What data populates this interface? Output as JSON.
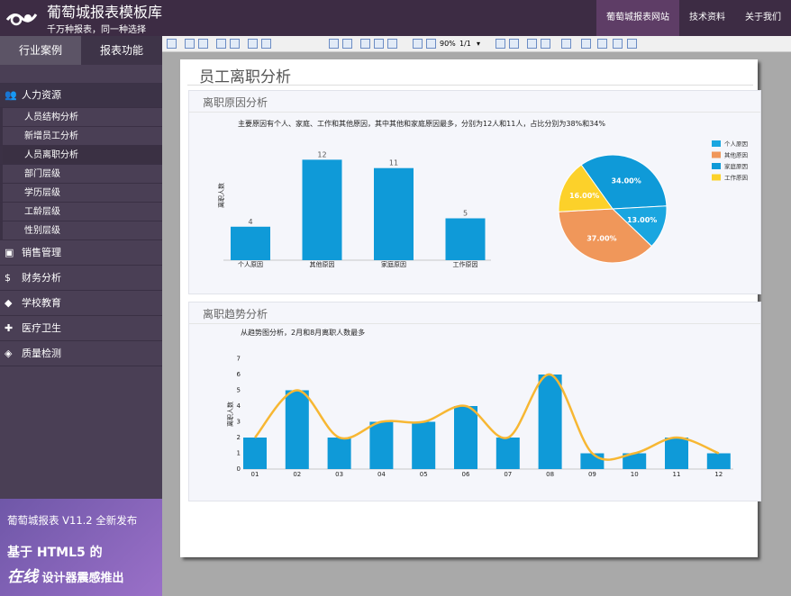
{
  "header": {
    "brand": "葡萄城报表模板库",
    "slogan": "千万种报表，同一种选择",
    "nav": [
      "葡萄城报表网站",
      "技术资料",
      "关于我们"
    ]
  },
  "sidebar": {
    "tabs": [
      "行业案例",
      "报表功能"
    ],
    "groups": [
      {
        "label": "人力资源",
        "icon": "people-icon",
        "items": [
          "人员结构分析",
          "新增员工分析",
          "人员离职分析",
          "部门层级",
          "学历层级",
          "工龄层级",
          "性别层级"
        ]
      },
      {
        "label": "销售管理",
        "icon": "chart-icon"
      },
      {
        "label": "财务分析",
        "icon": "money-bag-icon"
      },
      {
        "label": "学校教育",
        "icon": "graduation-cap-icon"
      },
      {
        "label": "医疗卫生",
        "icon": "medical-kit-icon"
      },
      {
        "label": "质量检测",
        "icon": "quality-badge-icon"
      }
    ],
    "promo": {
      "line1": "葡萄城报表 V11.2 全新发布",
      "line2": "基于 HTML5 的",
      "line3a": "在线",
      "line3b": " 设计器震感推出"
    }
  },
  "toolbar": {
    "zoom": "90%",
    "page": "1/1"
  },
  "report": {
    "title": "员工离职分析",
    "panel1": {
      "title": "离职原因分析",
      "desc": "主要原因有个人、家庭、工作和其他原因，其中其他和家庭原因最多，分别为12人和11人，占比分别为38%和34%"
    },
    "panel2": {
      "title": "离职趋势分析",
      "desc": "从趋势图分析，2月和8月离职人数最多"
    }
  },
  "chart_data": [
    {
      "type": "bar",
      "categories": [
        "个人原因",
        "其他原因",
        "家庭原因",
        "工作原因"
      ],
      "values": [
        4,
        12,
        11,
        5
      ],
      "ylabel": "离职人数",
      "color": "#0f9ad8"
    },
    {
      "type": "pie",
      "labels": [
        "个人原因",
        "其他原因",
        "家庭原因",
        "工作原因"
      ],
      "values": [
        13.0,
        37.0,
        34.0,
        16.0
      ],
      "colors": [
        "#1aa6e0",
        "#f0975a",
        "#0f9ad8",
        "#fcd12a"
      ],
      "legend": "top-right"
    },
    {
      "type": "bar",
      "categories": [
        "01",
        "02",
        "03",
        "04",
        "05",
        "06",
        "07",
        "08",
        "09",
        "10",
        "11",
        "12"
      ],
      "values": [
        2,
        5,
        2,
        3,
        3,
        4,
        2,
        6,
        1,
        1,
        2,
        1
      ],
      "ylabel": "离职人数",
      "ylim": [
        0,
        7
      ],
      "yticks": [
        0,
        1,
        2,
        3,
        4,
        5,
        6,
        7
      ],
      "color": "#0f9ad8",
      "line_color": "#f7b733"
    }
  ]
}
